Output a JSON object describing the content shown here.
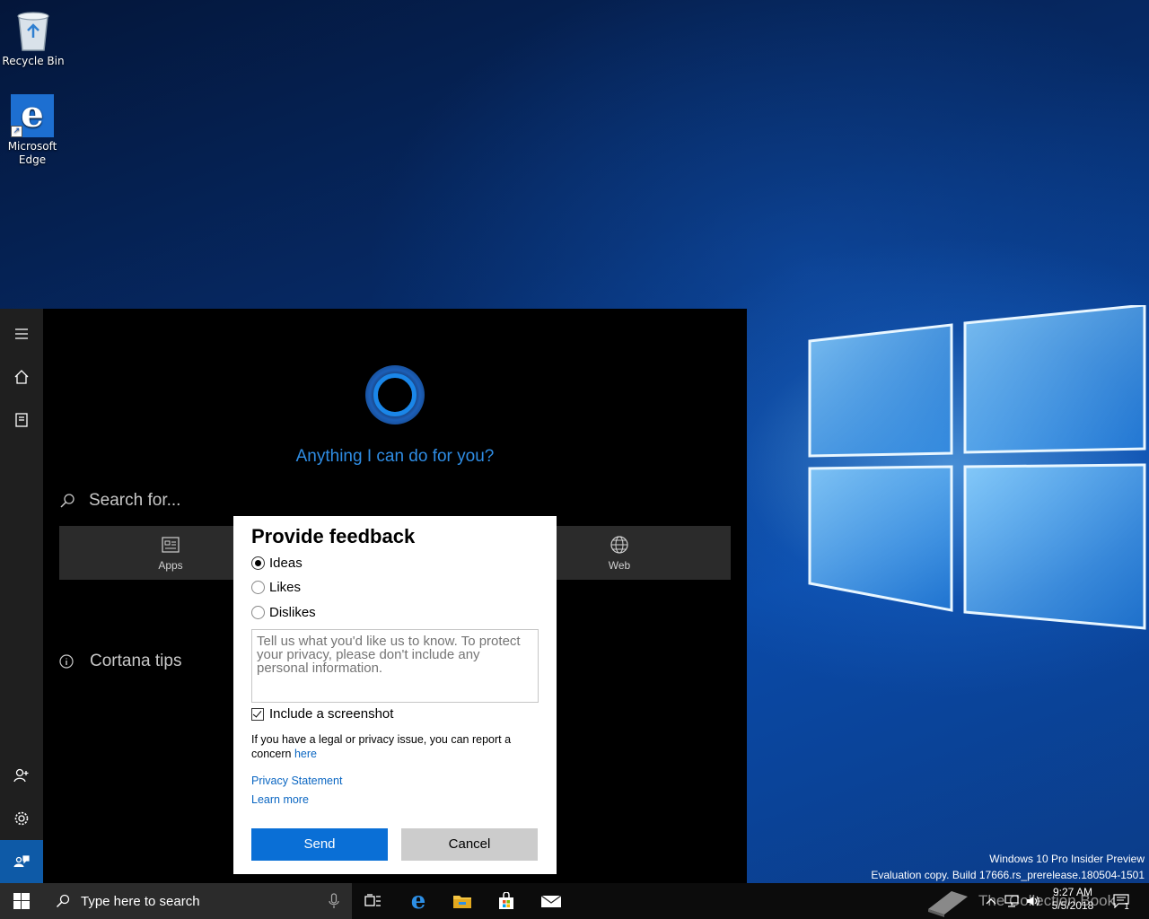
{
  "desktop": {
    "icons": [
      {
        "label": "Recycle Bin"
      },
      {
        "label": "Microsoft Edge"
      }
    ]
  },
  "cortana": {
    "prompt": "Anything I can do for you?",
    "search_placeholder": "Search for...",
    "filters": [
      {
        "label": "Apps",
        "icon": "apps-icon"
      },
      {
        "label": "Web",
        "icon": "globe-icon"
      }
    ],
    "tips_label": "Cortana tips",
    "rail_icons": [
      "hamburger-menu-icon",
      "home-icon",
      "notebook-icon",
      "add-account-icon",
      "settings-icon",
      "feedback-icon"
    ]
  },
  "feedback_dialog": {
    "title": "Provide feedback",
    "options": [
      {
        "label": "Ideas",
        "selected": true
      },
      {
        "label": "Likes",
        "selected": false
      },
      {
        "label": "Dislikes",
        "selected": false
      }
    ],
    "textarea_placeholder": "Tell us what you'd like us to know. To protect your privacy, please don't include any personal information.",
    "include_screenshot_label": "Include a screenshot",
    "include_screenshot_checked": true,
    "legal_text": "If you have a legal or privacy issue, you can report a concern",
    "legal_link": "here",
    "privacy_link": "Privacy Statement",
    "learn_more_link": "Learn more",
    "send_label": "Send",
    "cancel_label": "Cancel",
    "colors": {
      "accent": "#0a6fd6",
      "link": "#0a66c2"
    }
  },
  "watermark": {
    "line1": "Windows 10 Pro Insider Preview",
    "line2": "Evaluation copy. Build 17666.rs_prerelease.180504-1501"
  },
  "taskbar": {
    "search_placeholder": "Type here to search",
    "apps": [
      "task-view-icon",
      "edge-icon",
      "file-explorer-icon",
      "store-icon",
      "mail-icon"
    ],
    "overlay_text": "The Collection Book",
    "time": "9:27 AM",
    "date": "5/5/2018",
    "notification_count": "1"
  }
}
